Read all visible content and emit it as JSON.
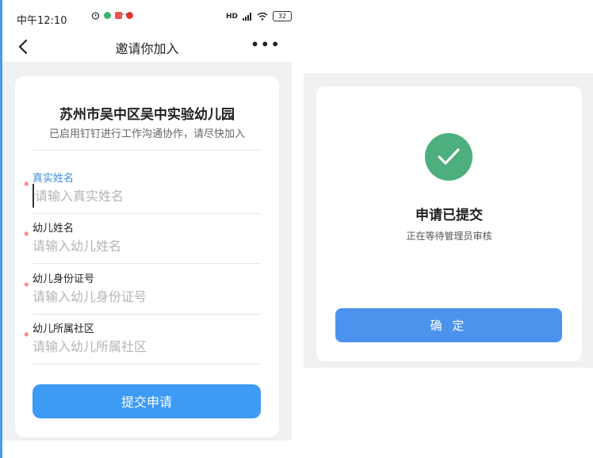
{
  "status_bar": {
    "time": "中午12:10",
    "more": "···",
    "signal": "HD",
    "battery": "32"
  },
  "nav": {
    "title": "邀请你加入",
    "more": "•••"
  },
  "org": {
    "name": "苏州市吴中区吴中实验幼儿园",
    "subtitle": "已启用钉钉进行工作沟通协作，请尽快加入"
  },
  "form": {
    "required_mark": "*",
    "fields": [
      {
        "label": "真实姓名",
        "placeholder": "请输入真实姓名",
        "value": ""
      },
      {
        "label": "幼儿姓名",
        "placeholder": "请输入幼儿姓名",
        "value": ""
      },
      {
        "label": "幼儿身份证号",
        "placeholder": "请输入幼儿身份证号",
        "value": ""
      },
      {
        "label": "幼儿所属社区",
        "placeholder": "请输入幼儿所属社区",
        "value": ""
      }
    ],
    "submit_label": "提交申请"
  },
  "dialog": {
    "title": "申请已提交",
    "subtitle": "正在等待管理员审核",
    "confirm_label": "确 定"
  },
  "colors": {
    "accent": "#3d9af5",
    "success": "#4caf7d",
    "required": "#e53935",
    "page_bg": "#f1f1f3"
  },
  "icons": [
    "back-arrow-icon",
    "more-icon",
    "alarm-icon",
    "wechat-icon",
    "app-icon",
    "signal-icon",
    "wifi-icon",
    "battery-icon",
    "checkmark-icon"
  ]
}
